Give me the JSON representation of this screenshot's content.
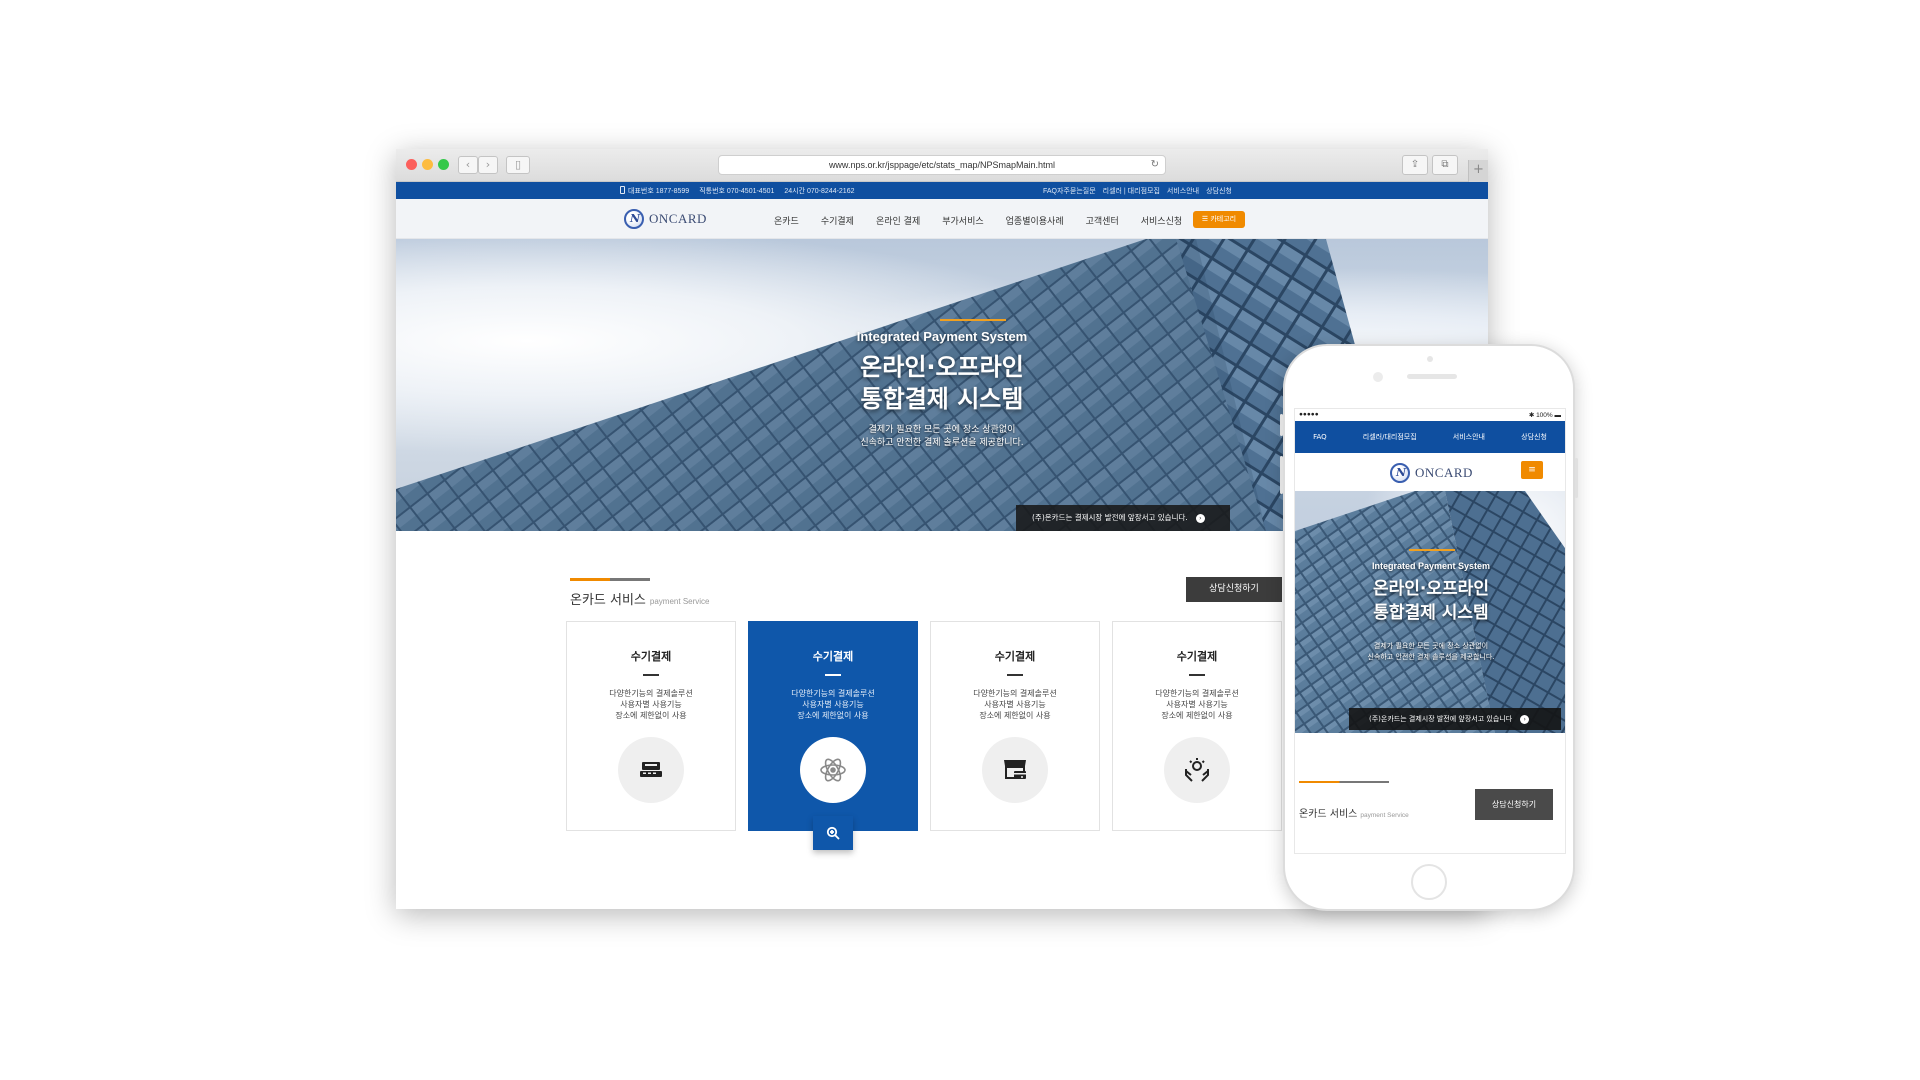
{
  "browser": {
    "url": "www.nps.or.kr/jsppage/etc/stats_map/NPSmapMain.html",
    "traffic_colors": [
      "#fc605c",
      "#fdbc40",
      "#34c84a"
    ]
  },
  "topbar": {
    "rep_phone": "대표번호 1877-8599",
    "direct_phone": "직통번호 070-4501-4501",
    "hours_phone": "24시간 070-8244-2162",
    "links": [
      "FAQ자주묻는질문",
      "리셀러 | 대리점모집",
      "서비스안내",
      "상담신청"
    ]
  },
  "brand": {
    "name": "ONCARD",
    "accent": "#f08a00",
    "primary": "#0f57aa"
  },
  "nav": {
    "items": [
      "온카드",
      "수기결제",
      "온라인 결제",
      "부가서비스",
      "업종별이용사례",
      "고객센터",
      "서비스신청"
    ],
    "category_button": "☰ 카테고리"
  },
  "hero": {
    "subtitle": "Integrated Payment System",
    "title_line1": "온라인·오프라인",
    "title_line2": "통합결제 시스템",
    "desc_line1": "결제가 필요한 모든 곳에 장소 상관없이",
    "desc_line2": "신속하고 안전한 결제 솔루션을 제공합니다.",
    "note": "(주)온카드는 결제시장 발전에 앞장서고 있습니다."
  },
  "services": {
    "title": "온카드 서비스",
    "title_en": "payment Service",
    "consult_button": "상담신청하기",
    "cards": [
      {
        "title": "수기결제",
        "desc1": "다양한기능의 결제솔루션",
        "desc2": "사용자별 사용기능",
        "desc3": "장소에 제한없이 사용",
        "icon": "card-terminal-icon"
      },
      {
        "title": "수기결제",
        "desc1": "다양한기능의 결제솔루션",
        "desc2": "사용자별 사용기능",
        "desc3": "장소에 제한없이 사용",
        "icon": "atom-icon"
      },
      {
        "title": "수기결제",
        "desc1": "다양한기능의 결제솔루션",
        "desc2": "사용자별 사용기능",
        "desc3": "장소에 제한없이 사용",
        "icon": "store-card-icon"
      },
      {
        "title": "수기결제",
        "desc1": "다양한기능의 결제솔루션",
        "desc2": "사용자별 사용기능",
        "desc3": "장소에 제한없이 사용",
        "icon": "hands-bulb-icon"
      }
    ]
  },
  "mobile": {
    "status_left": "●●●●● ",
    "status_right": "✱ 100% ▬",
    "nav": [
      "FAQ",
      "리셀러/대리점모집",
      "서비스안내",
      "상담신청"
    ],
    "menu_icon": "≡",
    "hero_title_line1": "온라인·오프라인",
    "hero_title_line2": "통합결제 시스템",
    "hero_note": "(주)온카드는 결제시장 발전에 앞장서고 있습니다"
  }
}
